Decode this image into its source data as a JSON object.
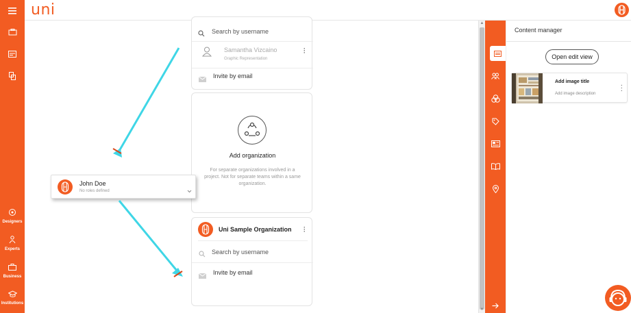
{
  "app": {
    "logo": "uni"
  },
  "sidebar": {
    "items": [
      {
        "label": "Designers",
        "icon": "designers-icon"
      },
      {
        "label": "Experts",
        "icon": "experts-icon"
      },
      {
        "label": "Business",
        "icon": "business-icon"
      },
      {
        "label": "Institutions",
        "icon": "institutions-icon"
      }
    ]
  },
  "team_card": {
    "search_placeholder": "Search by username",
    "member": {
      "name": "Samantha Vizcaino",
      "role": "Graphic Representation"
    },
    "invite_label": "Invite by email"
  },
  "add_org": {
    "title": "Add organization",
    "description": "For separate organizations involved in a project. Not for separate teams within a same organization."
  },
  "sample_org": {
    "name": "Uni Sample Organization",
    "search_placeholder": "Search by username",
    "invite_label": "Invite by email"
  },
  "floating_user": {
    "name": "John Doe",
    "roles": "No roles defined"
  },
  "content_manager": {
    "title": "Content manager",
    "edit_button": "Open edit view",
    "image": {
      "title": "Add image title",
      "description": "Add image description"
    }
  },
  "colors": {
    "brand": "#f25c22",
    "arrow": "#3fd6e6"
  }
}
